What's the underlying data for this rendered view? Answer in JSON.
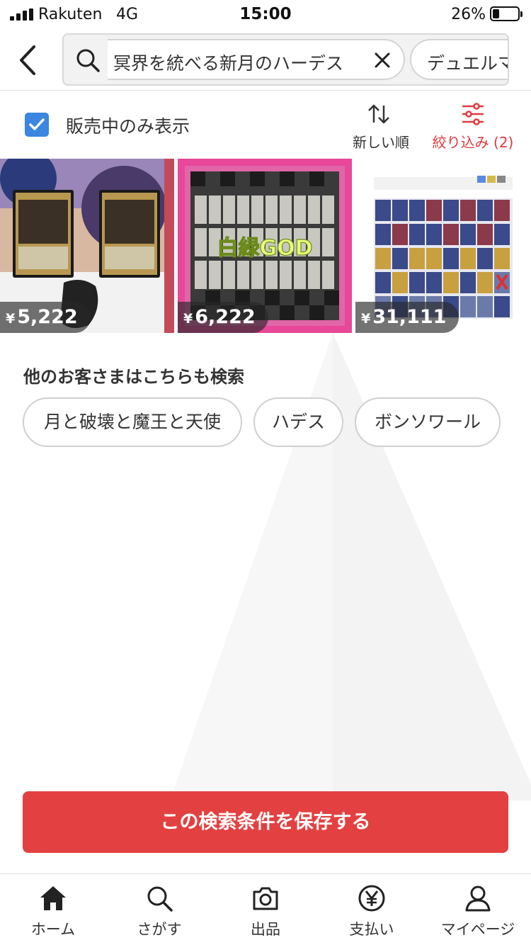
{
  "status_bar": {
    "carrier": "Rakuten",
    "network": "4G",
    "time": "15:00",
    "battery": "26%",
    "battery_level": 0.26
  },
  "search": {
    "query": "冥界を統べる新月のハーデス",
    "query_next": "デュエルマ",
    "back_icon": "chevron-left-icon",
    "search_icon": "search-icon",
    "clear_icon": "close-icon"
  },
  "filters": {
    "on_sale_only_label": "販売中のみ表示",
    "on_sale_only_checked": true,
    "sort_label": "新しい順",
    "filter_label": "絞り込み (2)",
    "accent_color": "#e0393d",
    "checkbox_color": "#3a86e0"
  },
  "products": [
    {
      "price": "5,222",
      "currency": "¥"
    },
    {
      "price": "6,222",
      "currency": "¥",
      "image_text": "白緑GOD"
    },
    {
      "price": "31,111",
      "currency": "¥"
    }
  ],
  "related": {
    "title": "他のお客さまはこちらも検索",
    "chips": [
      "月と破壊と魔王と天使",
      "ハデス",
      "ボンソワール"
    ]
  },
  "save_button": {
    "label": "この検索条件を保存する",
    "color": "#e34141"
  },
  "tab_bar": {
    "tabs": [
      {
        "label": "ホーム",
        "icon": "home-icon"
      },
      {
        "label": "さがす",
        "icon": "search-icon"
      },
      {
        "label": "出品",
        "icon": "camera-icon"
      },
      {
        "label": "支払い",
        "icon": "yen-icon"
      },
      {
        "label": "マイページ",
        "icon": "user-icon"
      }
    ]
  }
}
